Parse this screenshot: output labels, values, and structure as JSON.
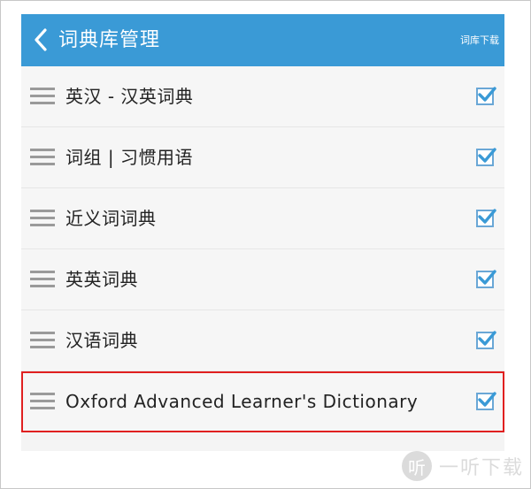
{
  "header": {
    "title": "词典库管理",
    "download_label": "词库下载"
  },
  "colors": {
    "header_bg": "#3a9ad6",
    "checkbox": "#3a9ad6",
    "highlight_border": "#e02020"
  },
  "dictionaries": [
    {
      "label": "英汉 - 汉英词典",
      "checked": true
    },
    {
      "label": "词组 | 习惯用语",
      "checked": true
    },
    {
      "label": "近义词词典",
      "checked": true
    },
    {
      "label": "英英词典",
      "checked": true
    },
    {
      "label": "汉语词典",
      "checked": true
    },
    {
      "label": "Oxford Advanced Learner's Dictionary",
      "checked": true,
      "highlighted": true
    }
  ],
  "watermark": {
    "logo_char": "听",
    "text": "一听下载"
  }
}
